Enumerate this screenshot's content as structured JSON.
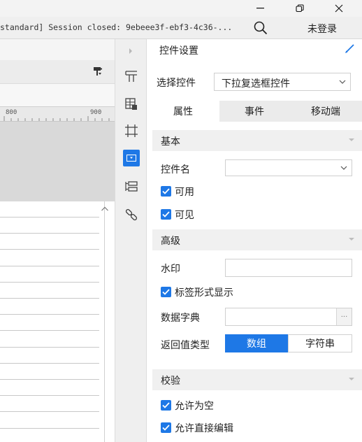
{
  "window": {
    "minimize_glyph": "−",
    "close_glyph": "✕"
  },
  "session": {
    "text": "standard] Session closed: 9ebeee3f-ebf3-4c36-...",
    "login_label": "未登录"
  },
  "ruler": {
    "ticks": [
      "800",
      "900"
    ]
  },
  "panel": {
    "title": "控件设置",
    "select_widget_label": "选择控件",
    "select_widget_value": "下拉复选框控件",
    "tabs": [
      {
        "label": "属性",
        "active": true
      },
      {
        "label": "事件",
        "active": false
      },
      {
        "label": "移动端",
        "active": false
      }
    ],
    "basic": {
      "title": "基本",
      "widget_name_label": "控件名",
      "widget_name_value": "",
      "enabled_label": "可用",
      "enabled_checked": true,
      "visible_label": "可见",
      "visible_checked": true
    },
    "advanced": {
      "title": "高级",
      "watermark_label": "水印",
      "watermark_value": "",
      "tag_display_label": "标签形式显示",
      "tag_display_checked": true,
      "dictionary_label": "数据字典",
      "dictionary_value": "",
      "dictionary_button": "···",
      "return_type_label": "返回值类型",
      "return_type_options": [
        "数组",
        "字符串"
      ],
      "return_type_selected": "数组"
    },
    "validation": {
      "title": "校验",
      "allow_empty_label": "允许为空",
      "allow_empty_checked": true,
      "allow_edit_label": "允许直接编辑",
      "allow_edit_checked": true
    }
  },
  "colors": {
    "accent": "#1e78e6",
    "tab_active_bg": "#ffffff",
    "tab_inactive_bg": "#ebebeb"
  }
}
